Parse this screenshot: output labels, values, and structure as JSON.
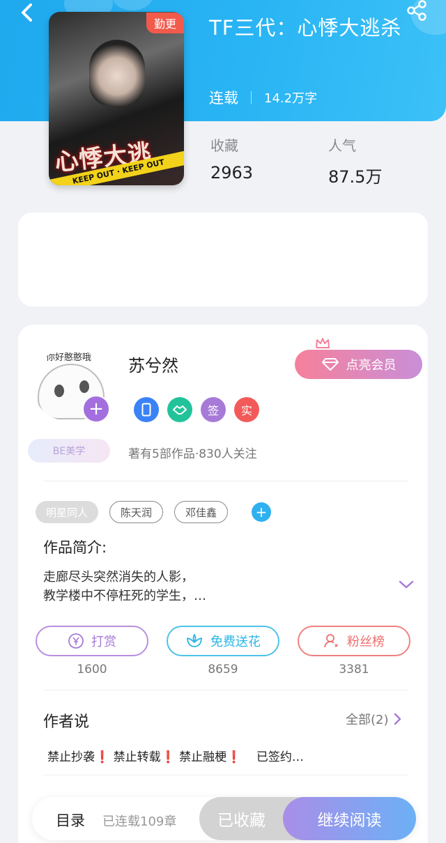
{
  "header": {
    "back_icon": "chevron-left-icon",
    "share_icon": "share-icon"
  },
  "book": {
    "cover_badge": "勤更",
    "title": "TF三代：心悸大逃杀",
    "status": "连载",
    "word_count": "14.2万字",
    "stats": [
      {
        "label": "收藏",
        "value": "2963"
      },
      {
        "label": "人气",
        "value": "87.5万"
      }
    ]
  },
  "author": {
    "name": "苏兮然",
    "avatar_note": "你好憨憨哦",
    "tag": "BE美学",
    "stats_text": "著有5部作品·830人关注",
    "badges": [
      {
        "icon": "phone-icon",
        "text": "",
        "color": "#3b82f6"
      },
      {
        "icon": "handshake-icon",
        "text": "",
        "color": "#22c39a"
      },
      {
        "icon": "sign-icon",
        "text": "签",
        "color": "#a77ad8"
      },
      {
        "icon": "verified-icon",
        "text": "实",
        "color": "#f25a5a"
      }
    ],
    "vip_button": "点亮会员"
  },
  "tags": [
    "明星同人",
    "陈天润",
    "邓佳鑫"
  ],
  "intro": {
    "title": "作品简介:",
    "line1": "走廊尽头突然消失的人影，",
    "line2": "教学楼中不停枉死的学生，…"
  },
  "actions": [
    {
      "label": "打赏",
      "count": "1600",
      "icon": "yen-icon",
      "color": "#a77ad8"
    },
    {
      "label": "免费送花",
      "count": "8659",
      "icon": "flower-icon",
      "color": "#2bb5e6"
    },
    {
      "label": "粉丝榜",
      "count": "3381",
      "icon": "fans-icon",
      "color": "#ef6f6f"
    }
  ],
  "author_says": {
    "title": "作者说",
    "all_label": "全部(2)",
    "text": "禁止抄袭❗ 禁止转载❗ 禁止融梗❗    已签约…"
  },
  "bottom": {
    "menu_label": "目录",
    "chapters": "已连载109章",
    "fav_label": "已收藏",
    "read_label": "继续阅读"
  }
}
